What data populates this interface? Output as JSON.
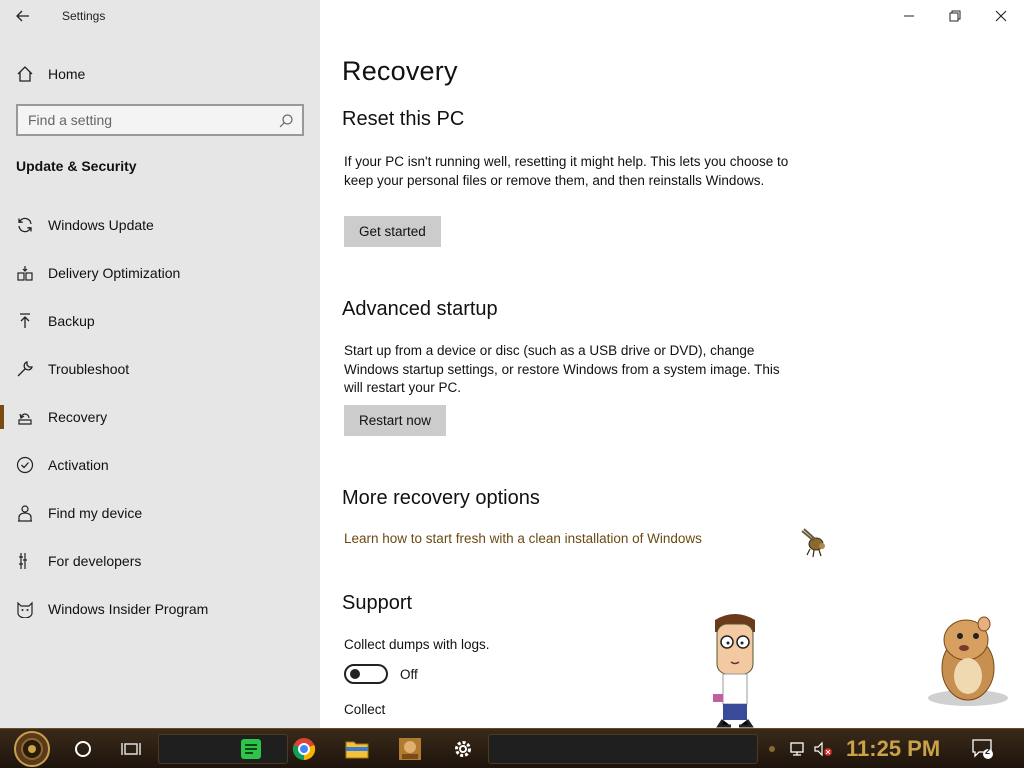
{
  "window": {
    "title": "Settings"
  },
  "sidebar": {
    "home_label": "Home",
    "search_placeholder": "Find a setting",
    "section_title": "Update & Security",
    "items": [
      {
        "label": "Windows Update",
        "icon": "sync-icon"
      },
      {
        "label": "Delivery Optimization",
        "icon": "delivery-optimization-icon"
      },
      {
        "label": "Backup",
        "icon": "backup-arrow-icon"
      },
      {
        "label": "Troubleshoot",
        "icon": "wrench-icon"
      },
      {
        "label": "Recovery",
        "icon": "recovery-icon",
        "selected": true
      },
      {
        "label": "Activation",
        "icon": "check-circle-icon"
      },
      {
        "label": "Find my device",
        "icon": "person-location-icon"
      },
      {
        "label": "For developers",
        "icon": "developer-tools-icon"
      },
      {
        "label": "Windows Insider Program",
        "icon": "insider-cat-icon"
      }
    ]
  },
  "main": {
    "page_title": "Recovery",
    "reset": {
      "heading": "Reset this PC",
      "description": "If your PC isn't running well, resetting it might help. This lets you choose to keep your personal files or remove them, and then reinstalls Windows.",
      "button": "Get started"
    },
    "advanced": {
      "heading": "Advanced startup",
      "description": "Start up from a device or disc (such as a USB drive or DVD), change Windows startup settings, or restore Windows from a system image. This will restart your PC.",
      "button": "Restart now"
    },
    "more": {
      "heading": "More recovery options",
      "link": "Learn how to start fresh with a clean installation of Windows"
    },
    "support": {
      "heading": "Support",
      "collect_dumps_label": "Collect dumps with logs.",
      "toggle_state": "Off",
      "collect_label": "Collect"
    }
  },
  "taskbar": {
    "clock": "11:25 PM",
    "notification_count": "2"
  },
  "colors": {
    "sidebar_bg": "#e6e6e6",
    "accent": "#7a4a12",
    "link": "#6b4a14",
    "button_bg": "#cccccc",
    "taskbar_bg": "#2a1c10",
    "clock": "#c9a24a"
  }
}
